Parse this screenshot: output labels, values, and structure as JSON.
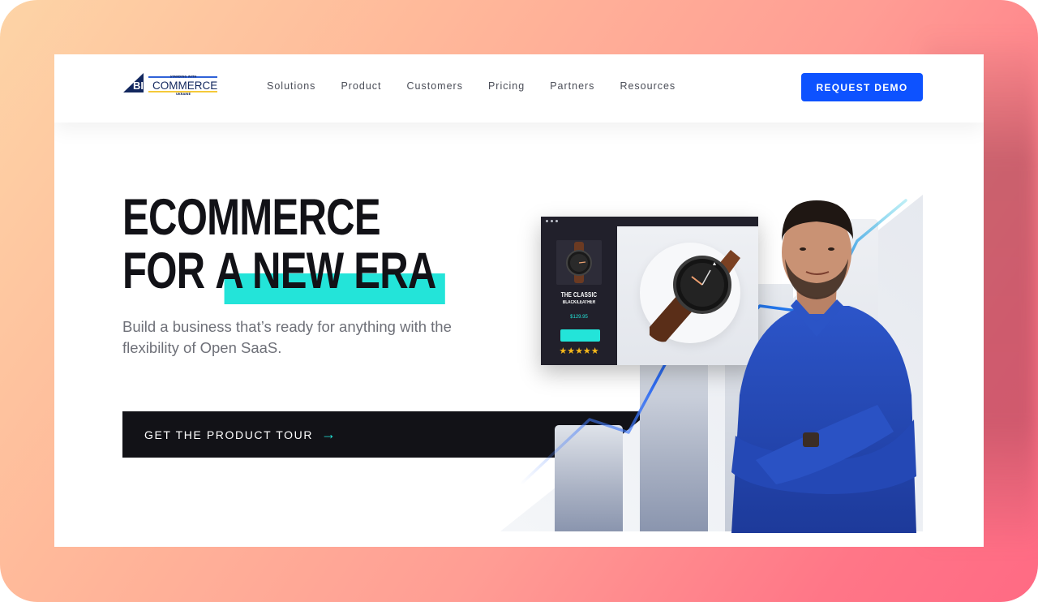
{
  "brand": {
    "name": "BIGCOMMERCE",
    "tagline_top": "STANDING WITH",
    "tagline_bottom": "UKRAINE"
  },
  "nav": {
    "items": [
      {
        "label": "Solutions"
      },
      {
        "label": "Product"
      },
      {
        "label": "Customers"
      },
      {
        "label": "Pricing"
      },
      {
        "label": "Partners"
      },
      {
        "label": "Resources"
      }
    ],
    "cta_label": "REQUEST DEMO"
  },
  "hero": {
    "headline_line1": "ECOMMERCE",
    "headline_line2_prefix": "FOR ",
    "headline_line2_highlight": "A NEW ERA",
    "subtext": "Build a business that’s ready for anything with the flexibility of Open SaaS.",
    "tour_button_label": "GET THE PRODUCT TOUR",
    "tour_button_icon": "→"
  },
  "product_card": {
    "title": "THE CLASSIC",
    "subtitle": "BLACK/LEATHER",
    "price": "$129.95",
    "stars": "★★★★★",
    "rating": 5
  },
  "colors": {
    "accent_blue": "#0d52ff",
    "accent_teal": "#23e4d9",
    "dark": "#121217",
    "star": "#f6b81a"
  }
}
